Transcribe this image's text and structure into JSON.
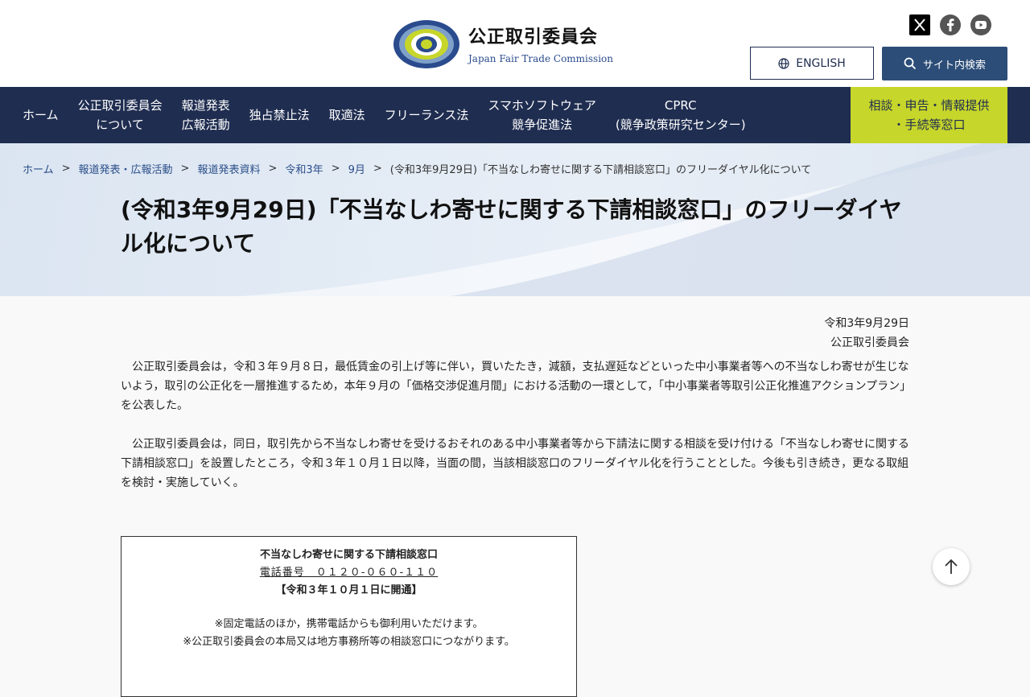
{
  "header": {
    "logo_ja": "公正取引委員会",
    "logo_en": "Japan Fair Trade Commission",
    "social_icons": [
      "x-icon",
      "facebook-icon",
      "youtube-icon"
    ],
    "english_label": "ENGLISH",
    "search_label": "サイト内検索"
  },
  "nav": {
    "items": [
      {
        "label": "ホーム"
      },
      {
        "label": "公正取引委員会\nについて"
      },
      {
        "label": "報道発表\n広報活動"
      },
      {
        "label": "独占禁止法"
      },
      {
        "label": "取適法"
      },
      {
        "label": "フリーランス法"
      },
      {
        "label": "スマホソフトウェア\n競争促進法"
      },
      {
        "label": "CPRC\n(競争政策研究センター)"
      }
    ],
    "cta_label": "相談・申告・情報提供\n・手続等窓口"
  },
  "breadcrumb": {
    "items": [
      "ホーム",
      "報道発表・広報活動",
      "報道発表資料",
      "令和3年",
      "9月"
    ],
    "current": "(令和3年9月29日)「不当なしわ寄せに関する下請相談窓口」のフリーダイヤル化について",
    "separator": ">"
  },
  "page": {
    "title": "(令和3年9月29日)「不当なしわ寄せに関する下請相談窓口」のフリーダイヤル化について",
    "date": "令和3年9月29日",
    "issuer": "公正取引委員会",
    "paragraphs": [
      "公正取引委員会は，令和３年９月８日，最低賃金の引上げ等に伴い，買いたたき，減額，支払遅延などといった中小事業者等への不当なしわ寄せが生じないよう，取引の公正化を一層推進するため，本年９月の「価格交渉促進月間」における活動の一環として，「中小事業者等取引公正化推進アクションプラン」を公表した。",
      "公正取引委員会は，同日，取引先から不当なしわ寄せを受けるおそれのある中小事業者等から下請法に関する相談を受け付ける「不当なしわ寄せに関する下請相談窓口」を設置したところ，令和３年１０月１日以降，当面の間，当該相談窓口のフリーダイヤル化を行うこととした。今後も引き続き，更なる取組を検討・実施していく。"
    ],
    "box": {
      "title": "不当なしわ寄せに関する下請相談窓口",
      "phone": "電話番号　０１２０-０６０-１１０",
      "opening": "【令和３年１０月１日に開通】",
      "note1": "※固定電話のほか，携帯電話からも御利用いただけます。",
      "note2": "※公正取引委員会の本局又は地方事務所等の相談窓口につながります。"
    }
  },
  "colors": {
    "nav_bg": "#1f2d50",
    "cta_bg": "#c7d62a",
    "search_bg": "#2c4d78",
    "link": "#2b4e8a"
  }
}
